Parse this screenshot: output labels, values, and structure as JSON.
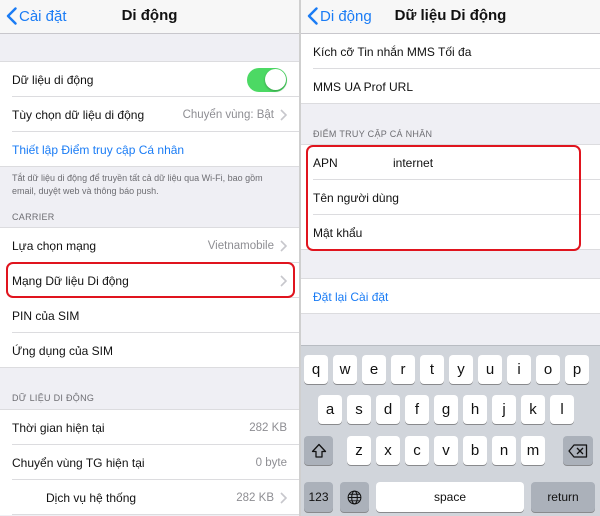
{
  "left": {
    "nav": {
      "back_label": "Cài đặt",
      "title": "Di động"
    },
    "cellular_data_label": "Dữ liệu di động",
    "cellular_data_enabled": true,
    "data_options_label": "Tùy chọn dữ liệu di động",
    "data_options_value": "Chuyển vùng: Bật",
    "hotspot_link": "Thiết lập Điểm truy cập Cá nhân",
    "footnote": "Tắt dữ liệu di động để truyền tất cả dữ liệu qua Wi-Fi, bao gồm email, duyệt web và thông báo push.",
    "carrier_header": "CARRIER",
    "network_selection_label": "Lựa chọn mạng",
    "network_selection_value": "Vietnamobile",
    "cellular_network_label": "Mạng Dữ liệu Di động",
    "sim_pin_label": "PIN của SIM",
    "sim_apps_label": "Ứng dụng của SIM",
    "usage_header": "DỮ LIỆU DI ĐỘNG",
    "usage_rows": [
      {
        "label": "Thời gian hiện tại",
        "value": "282 KB"
      },
      {
        "label": "Chuyển vùng TG hiện tại",
        "value": "0 byte"
      },
      {
        "label": "Dịch vụ hệ thống",
        "value": "282 KB"
      }
    ]
  },
  "right": {
    "nav": {
      "back_label": "Di động",
      "title": "Dữ liệu Di động"
    },
    "mms_size_label": "Kích cỡ Tin nhắn MMS Tối đa",
    "mms_ua_label": "MMS UA Prof URL",
    "hotspot_header": "ĐIỂM TRUY CẬP CÁ NHÂN",
    "apn_label": "APN",
    "apn_value": "internet",
    "username_label": "Tên người dùng",
    "password_label": "Mật khẩu",
    "reset_link": "Đặt lại Cài đặt"
  },
  "keyboard": {
    "row1": [
      "q",
      "w",
      "e",
      "r",
      "t",
      "y",
      "u",
      "i",
      "o",
      "p"
    ],
    "row2": [
      "a",
      "s",
      "d",
      "f",
      "g",
      "h",
      "j",
      "k",
      "l"
    ],
    "row3": [
      "z",
      "x",
      "c",
      "v",
      "b",
      "n",
      "m"
    ],
    "numbers_key": "123",
    "space_key": "space",
    "return_key": "return"
  },
  "colors": {
    "accent": "#1a7cf5",
    "toggle_on": "#4cd964",
    "highlight": "#e0141e"
  }
}
